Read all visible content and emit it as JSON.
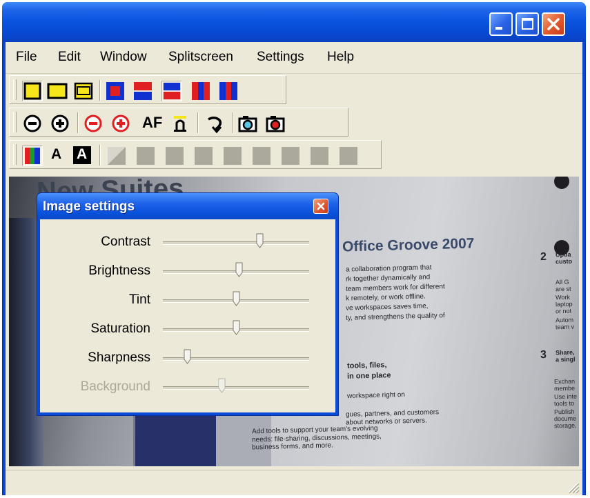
{
  "window": {
    "title": "",
    "controls": {
      "minimize": "minimize",
      "maximize": "maximize",
      "close": "close"
    }
  },
  "menu": [
    {
      "id": "file",
      "label": "File"
    },
    {
      "id": "edit",
      "label": "Edit"
    },
    {
      "id": "window",
      "label": "Window"
    },
    {
      "id": "splitscreen",
      "label": "Splitscreen"
    },
    {
      "id": "settings",
      "label": "Settings"
    },
    {
      "id": "help",
      "label": "Help"
    }
  ],
  "toolbar_layout": {
    "buttons": [
      "single-view-icon",
      "wide-view-icon",
      "framed-view-icon",
      "split-blue-red-small-icon",
      "split-horizontal-red-blue-icon",
      "split-horizontal-blue-red-icon",
      "split-vertical-blue-red-blue-icon",
      "split-vertical-red-blue-red-icon"
    ]
  },
  "toolbar_zoom": {
    "buttons": [
      "zoom-out-icon",
      "zoom-in-icon",
      "zoom-out-red-icon",
      "zoom-in-red-icon",
      "autofocus-icon",
      "focus-icon",
      "rotate-icon",
      "snapshot-icon",
      "snapshot-red-icon"
    ],
    "af_label": "AF"
  },
  "toolbar_color": {
    "buttons": [
      "color-mode-icon",
      "text-mode-icon",
      "text-inverse-icon",
      "contrast-filter-icon",
      "filter-slot-icon"
    ],
    "text_label": "A",
    "text_inverse_label": "A"
  },
  "dialog": {
    "title": "Image settings",
    "close": "close",
    "sliders": [
      {
        "id": "contrast",
        "label": "Contrast",
        "value": 0.67,
        "enabled": true
      },
      {
        "id": "brightness",
        "label": "Brightness",
        "value": 0.52,
        "enabled": true
      },
      {
        "id": "tint",
        "label": "Tint",
        "value": 0.5,
        "enabled": true
      },
      {
        "id": "saturation",
        "label": "Saturation",
        "value": 0.5,
        "enabled": true
      },
      {
        "id": "sharpness",
        "label": "Sharpness",
        "value": 0.15,
        "enabled": true
      },
      {
        "id": "background",
        "label": "Background",
        "value": 0.4,
        "enabled": false
      }
    ]
  },
  "camera_text": {
    "heading": "New Suites",
    "product": "Office Groove 2007",
    "col3_num2": "2",
    "col3_num3": "3",
    "para1": [
      "a collaboration program that",
      "rk together dynamically and",
      "team members work for different",
      "k remotely, or work offline.",
      "ve workspaces saves time,",
      "ty, and strengthens the quality of"
    ],
    "subhead1": "tools, files,",
    "subhead2": "in one place",
    "para2": "workspace right on",
    "para3": [
      "gues, partners, and customers",
      "about networks or servers.",
      "Add tools to support your team's evolving",
      "needs: file-sharing, discussions, meetings,",
      "business forms, and more."
    ],
    "col3": [
      "Upda",
      "custo",
      "All G",
      "are st",
      "Work",
      "laptop",
      "or not",
      "Autom",
      "team v",
      "Share,",
      "a singl",
      "Exchan",
      "membe",
      "Use inte",
      "tools to",
      "Publish",
      "docume",
      "storage,"
    ]
  },
  "colors": {
    "titlebar": "#0a55e0",
    "chrome": "#ece9d8",
    "accent_red": "#e02020",
    "accent_blue": "#1030d0",
    "accent_yellow": "#f4e61a"
  }
}
